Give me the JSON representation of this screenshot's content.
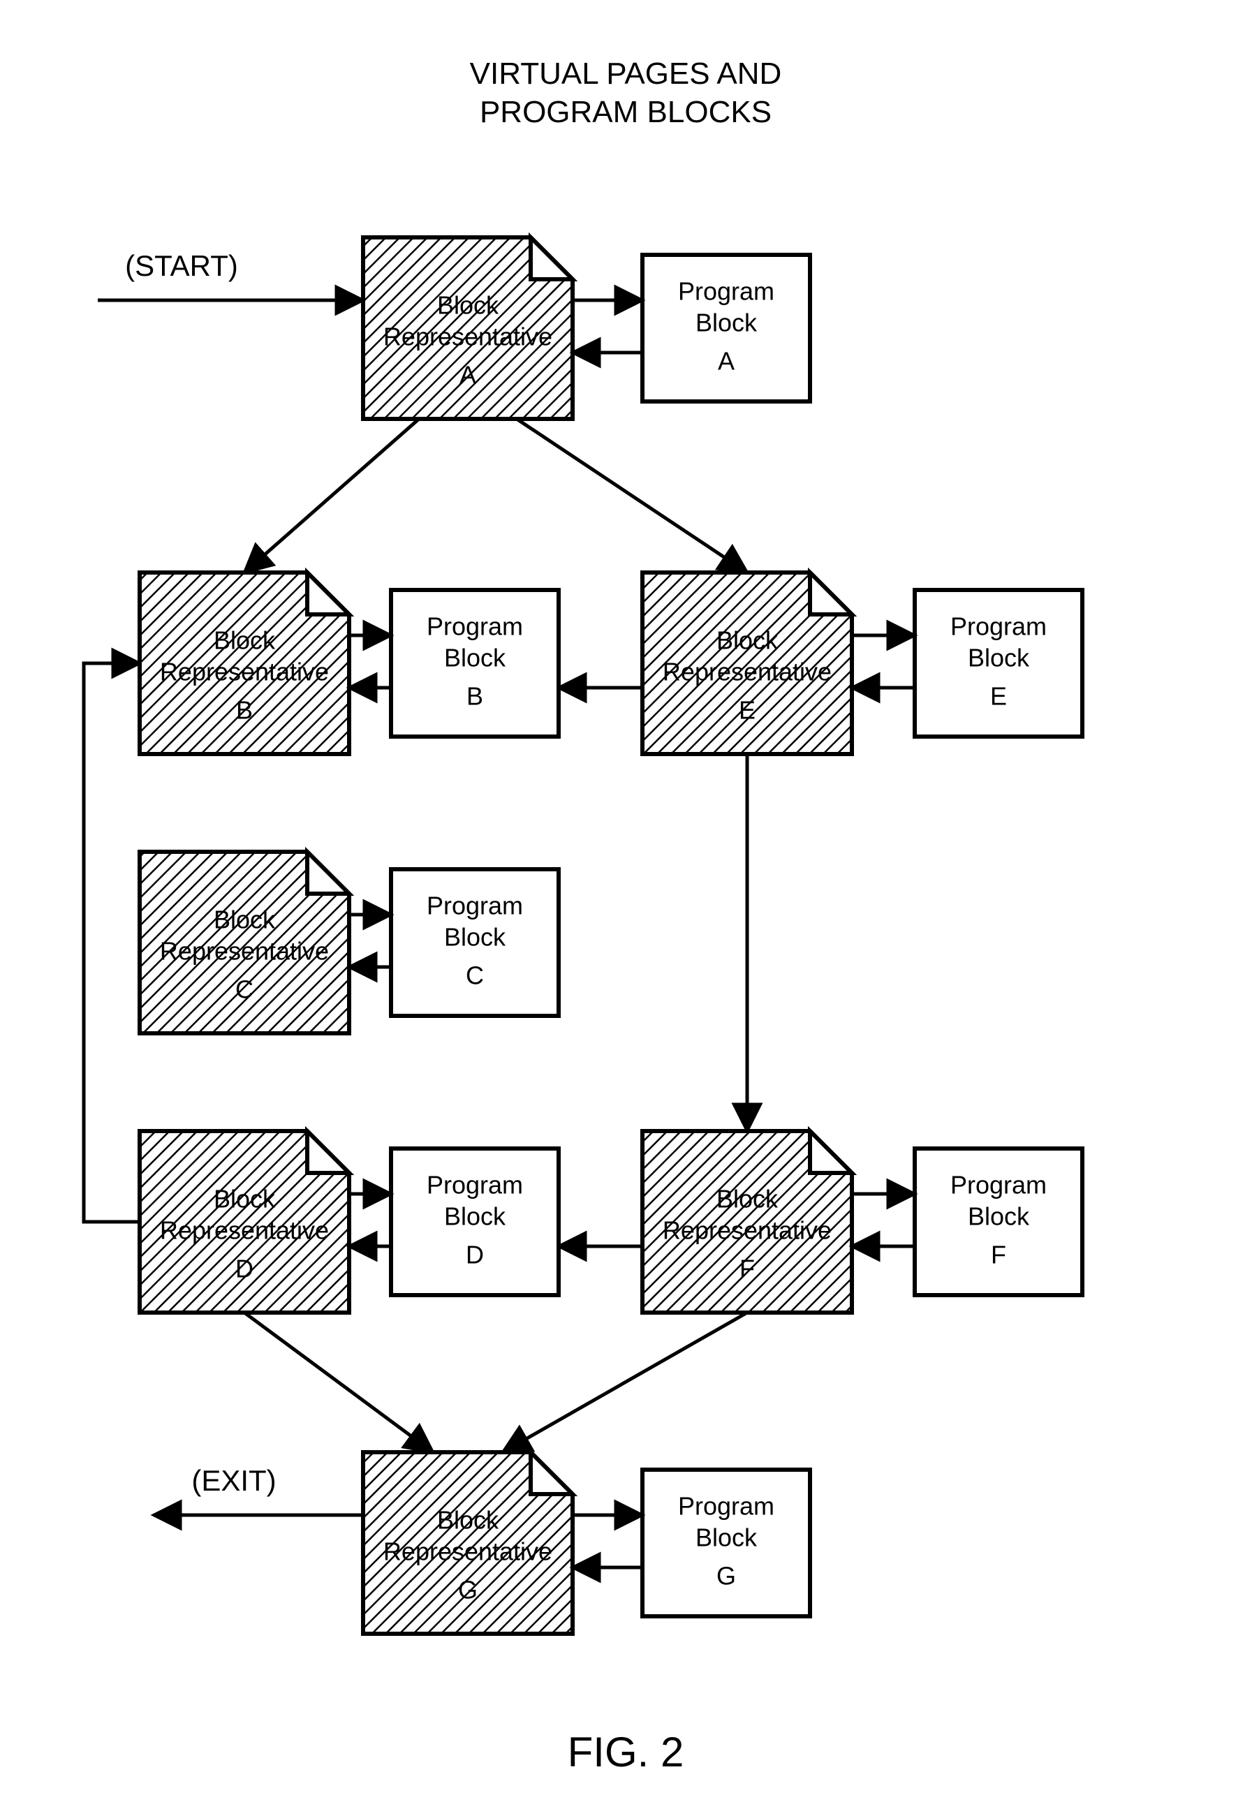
{
  "title_line1": "VIRTUAL PAGES AND",
  "title_line2": "PROGRAM BLOCKS",
  "start_label": "(START)",
  "exit_label": "(EXIT)",
  "fig_label": "FIG. 2",
  "nodes": {
    "A": {
      "rep_l1": "Block",
      "rep_l2": "Representative",
      "rep_l3": "A",
      "prog_l1": "Program",
      "prog_l2": "Block",
      "prog_l3": "A"
    },
    "B": {
      "rep_l1": "Block",
      "rep_l2": "Representative",
      "rep_l3": "B",
      "prog_l1": "Program",
      "prog_l2": "Block",
      "prog_l3": "B"
    },
    "C": {
      "rep_l1": "Block",
      "rep_l2": "Representative",
      "rep_l3": "C",
      "prog_l1": "Program",
      "prog_l2": "Block",
      "prog_l3": "C"
    },
    "D": {
      "rep_l1": "Block",
      "rep_l2": "Representative",
      "rep_l3": "D",
      "prog_l1": "Program",
      "prog_l2": "Block",
      "prog_l3": "D"
    },
    "E": {
      "rep_l1": "Block",
      "rep_l2": "Representative",
      "rep_l3": "E",
      "prog_l1": "Program",
      "prog_l2": "Block",
      "prog_l3": "E"
    },
    "F": {
      "rep_l1": "Block",
      "rep_l2": "Representative",
      "rep_l3": "F",
      "prog_l1": "Program",
      "prog_l2": "Block",
      "prog_l3": "F"
    },
    "G": {
      "rep_l1": "Block",
      "rep_l2": "Representative",
      "rep_l3": "G",
      "prog_l1": "Program",
      "prog_l2": "Block",
      "prog_l3": "G"
    }
  },
  "chart_data": {
    "type": "flowchart",
    "title": "VIRTUAL PAGES AND PROGRAM BLOCKS",
    "nodes": [
      {
        "id": "A",
        "kind": "block-representative",
        "label": "Block Representative A",
        "linked_program": "Program Block A"
      },
      {
        "id": "B",
        "kind": "block-representative",
        "label": "Block Representative B",
        "linked_program": "Program Block B"
      },
      {
        "id": "C",
        "kind": "block-representative",
        "label": "Block Representative C",
        "linked_program": "Program Block C"
      },
      {
        "id": "D",
        "kind": "block-representative",
        "label": "Block Representative D",
        "linked_program": "Program Block D"
      },
      {
        "id": "E",
        "kind": "block-representative",
        "label": "Block Representative E",
        "linked_program": "Program Block E"
      },
      {
        "id": "F",
        "kind": "block-representative",
        "label": "Block Representative F",
        "linked_program": "Program Block F"
      },
      {
        "id": "G",
        "kind": "block-representative",
        "label": "Block Representative G",
        "linked_program": "Program Block G"
      }
    ],
    "edges": [
      {
        "from": "START",
        "to": "A"
      },
      {
        "from": "A",
        "to": "B"
      },
      {
        "from": "A",
        "to": "E"
      },
      {
        "from": "E",
        "to": "B",
        "via": "Program Block B"
      },
      {
        "from": "E",
        "to": "F"
      },
      {
        "from": "F",
        "to": "D",
        "via": "Program Block D"
      },
      {
        "from": "D",
        "to": "B",
        "loop_back": true
      },
      {
        "from": "D",
        "to": "G"
      },
      {
        "from": "F",
        "to": "G"
      },
      {
        "from": "G",
        "to": "EXIT"
      }
    ],
    "program_links": [
      {
        "rep": "A",
        "program": "A",
        "bidirectional": true
      },
      {
        "rep": "B",
        "program": "B",
        "bidirectional": true
      },
      {
        "rep": "C",
        "program": "C",
        "bidirectional": true
      },
      {
        "rep": "D",
        "program": "D",
        "bidirectional": true
      },
      {
        "rep": "E",
        "program": "E",
        "bidirectional": true
      },
      {
        "rep": "F",
        "program": "F",
        "bidirectional": true
      },
      {
        "rep": "G",
        "program": "G",
        "bidirectional": true
      }
    ]
  }
}
